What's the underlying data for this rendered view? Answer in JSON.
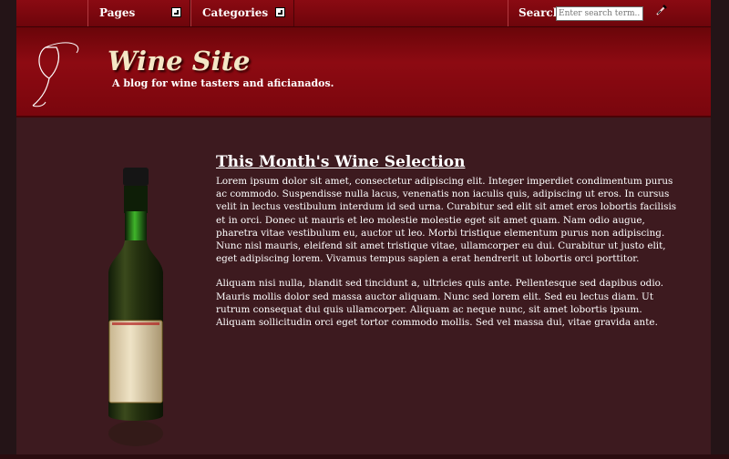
{
  "nav": {
    "pages_label": "Pages",
    "categories_label": "Categories",
    "search_label": "Search:",
    "search_placeholder": "Enter search term..."
  },
  "header": {
    "title": "Wine Site",
    "tagline": "A blog for wine tasters and aficianados."
  },
  "main": {
    "heading": "This Month's Wine Selection",
    "paragraphs": [
      "Lorem ipsum dolor sit amet, consectetur adipiscing elit. Integer imperdiet condimentum purus ac commodo. Suspendisse nulla lacus, venenatis non iaculis quis, adipiscing ut eros. In cursus velit in lectus vestibulum interdum id sed urna. Curabitur sed elit sit amet eros lobortis facilisis et in orci. Donec ut mauris et leo molestie molestie eget sit amet quam. Nam odio augue, pharetra vitae vestibulum eu, auctor ut leo. Morbi tristique elementum purus non adipiscing. Nunc nisl mauris, eleifend sit amet tristique vitae, ullamcorper eu dui. Curabitur ut justo elit, eget adipiscing lorem. Vivamus tempus sapien a erat hendrerit ut lobortis orci porttitor.",
      "Aliquam nisi nulla, blandit sed tincidunt a, ultricies quis ante. Pellentesque sed dapibus odio. Mauris mollis dolor sed massa auctor aliquam. Nunc sed lorem elit. Sed eu lectus diam. Ut rutrum consequat dui quis ullamcorper. Aliquam ac neque nunc, sit amet lobortis ipsum. Aliquam sollicitudin orci eget tortor commodo mollis. Sed vel massa dui, vitae gravida ante."
    ]
  },
  "colors": {
    "nav_red": "#8a0a12",
    "header_red": "#7a060d",
    "main_bg": "#3d1a1f",
    "title_cream": "#f4e7c6"
  }
}
